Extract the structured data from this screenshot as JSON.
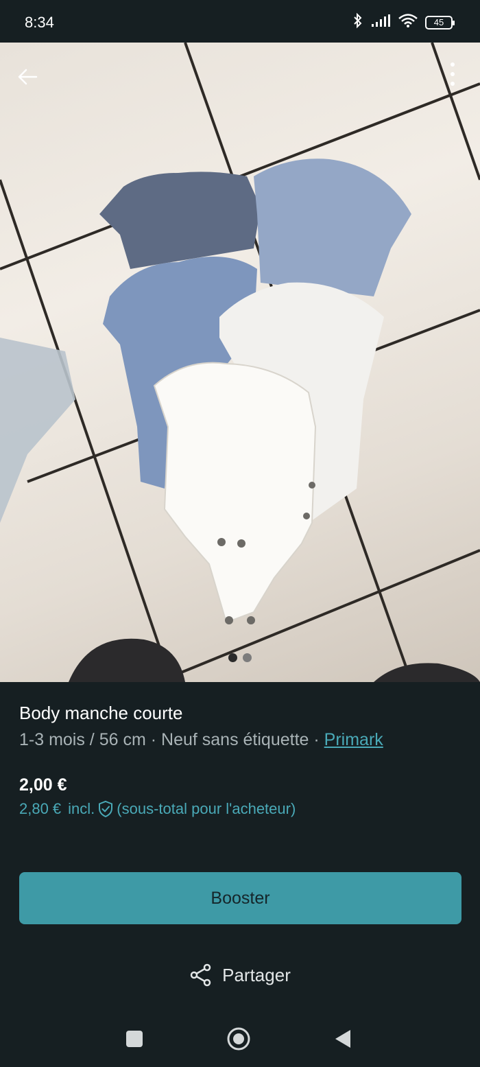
{
  "status_bar": {
    "time": "8:34",
    "battery": "45",
    "icons": [
      "bluetooth-icon",
      "signal-icon",
      "wifi-icon",
      "battery-icon"
    ]
  },
  "gallery": {
    "image": "baby bodysuits photo",
    "page_count": 2,
    "active_index": 0
  },
  "item": {
    "title": "Body manche courte",
    "size": "1-3 mois / 56 cm",
    "separator": "·",
    "condition": "Neuf sans étiquette",
    "brand": "Primark"
  },
  "pricing": {
    "price": "2,00 €",
    "buyer_total": "2,80 €",
    "incl_label": "incl.",
    "buyer_note": "(sous-total pour l'acheteur)"
  },
  "actions": {
    "booster_label": "Booster",
    "share_label": "Partager"
  },
  "colors": {
    "background": "#161f22",
    "accent": "#4aaab8",
    "button": "#3e9aa6"
  }
}
